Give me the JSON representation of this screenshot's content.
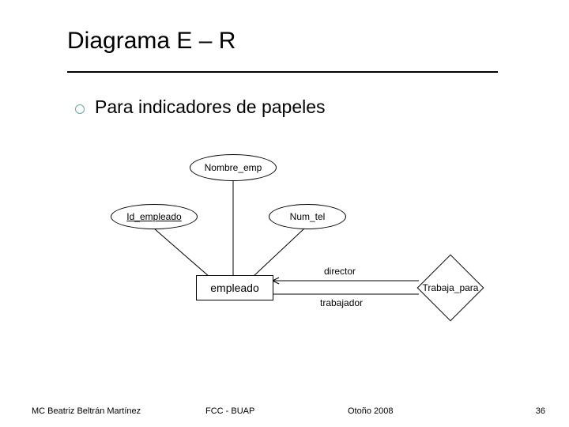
{
  "title": "Diagrama E – R",
  "bullet": "Para indicadores de papeles",
  "attributes": {
    "nombre_emp": "Nombre_emp",
    "id_empleado": "Id_empleado",
    "num_tel": "Num_tel"
  },
  "entity": {
    "empleado": "empleado"
  },
  "relationship": {
    "trabaja_para": "Trabaja_para"
  },
  "roles": {
    "director": "director",
    "trabajador": "trabajador"
  },
  "footer": {
    "author": "MC Beatriz Beltrán Martínez",
    "center": "FCC - BUAP",
    "semester": "Otoño 2008",
    "page": "36"
  }
}
